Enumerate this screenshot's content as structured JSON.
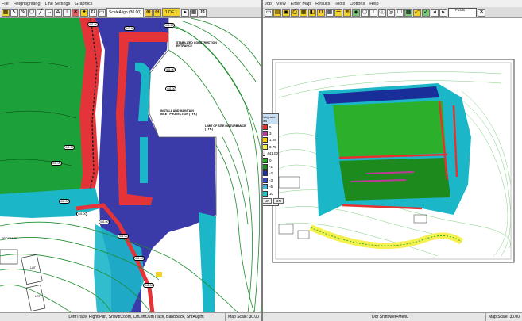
{
  "left": {
    "menu": [
      "File",
      "Heightighlang",
      "Line Settings",
      "Graphics"
    ],
    "scale_label": "ScaleAlign (30.00)",
    "page_label": "1 OF 1",
    "status_text": "LeftrTrace, RightrPan, ShiwdrZoom, CtrLeftrJumTrace, BandBack, ShrAugiht",
    "status_scale": "Map Scale: 30.00",
    "notes": [
      "STABILIZED CONSTRUCTION\nENTRANCE",
      "INSTALL AND MAINTAIN\nINLET PROTECTION (TYP.)",
      "LIMIT OF SITE DISTURBANCE\n(TYP.)"
    ],
    "tags": [
      "441.00",
      "441.50",
      "441.00",
      "441.00",
      "441.50",
      "441.00",
      "441.00",
      "441.00",
      "441.00",
      "441.00",
      "441.00",
      "441.00",
      "441.00"
    ],
    "lot_labels": [
      "FRONTAGE",
      "LOT",
      "LOT"
    ],
    "colors": {
      "fill": "#1ba03a",
      "cut": "#e4343a",
      "cut_deep": "#3a3aa8",
      "flat": "#1cb6c9",
      "contour": "#1c8c2c"
    }
  },
  "right": {
    "menu": [
      "Job",
      "View",
      "Enter Map",
      "Results",
      "Tools",
      "Options",
      "Help"
    ],
    "field_label": "Fields",
    "status_text": "Dor Shiftower+Menu",
    "status_scale": "Map Scale: 30.00",
    "legend": {
      "title": "Cut/grade Res",
      "values": [
        "5",
        "3",
        "1.25",
        "0.75",
        "441.00",
        "0",
        "-1",
        "-2",
        "-3",
        "-5",
        "10"
      ],
      "colors": [
        "#e83030",
        "#bb3a9c",
        "#ffc800",
        "#f5f04d",
        "#e4e4e4",
        "#2cb02c",
        "#1c8a1c",
        "#1a2e9a",
        "#3548c2",
        "#42b6d6",
        "#1cc8c8"
      ],
      "buttons": [
        "UP",
        "DN"
      ]
    }
  }
}
